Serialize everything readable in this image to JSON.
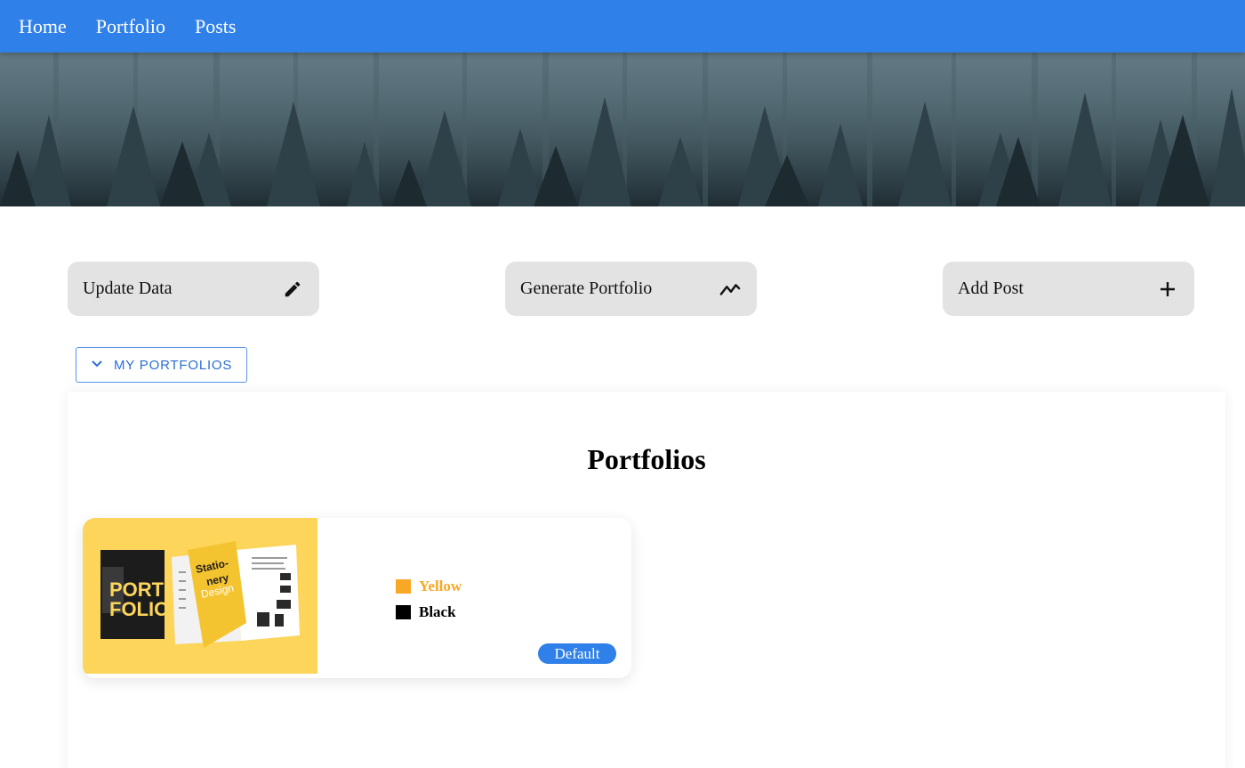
{
  "nav": {
    "items": [
      {
        "label": "Home"
      },
      {
        "label": "Portfolio"
      },
      {
        "label": "Posts"
      }
    ],
    "background_color": "#2f80e8"
  },
  "actions": [
    {
      "label": "Update Data",
      "icon": "pencil-icon"
    },
    {
      "label": "Generate Portfolio",
      "icon": "trending-line-icon"
    },
    {
      "label": "Add Post",
      "icon": "plus-icon"
    }
  ],
  "portfolios_toggle": {
    "label": "MY PORTFOLIOS",
    "icon": "chevron-down-icon"
  },
  "portfolios_panel": {
    "title": "Portfolios",
    "cards": [
      {
        "image_text": "PORT FOLIO",
        "image_subtext": "Statio- nery Design",
        "colors": [
          {
            "name": "Yellow",
            "hex": "#f9a825"
          },
          {
            "name": "Black",
            "hex": "#000000"
          }
        ],
        "badge": "Default"
      }
    ]
  }
}
